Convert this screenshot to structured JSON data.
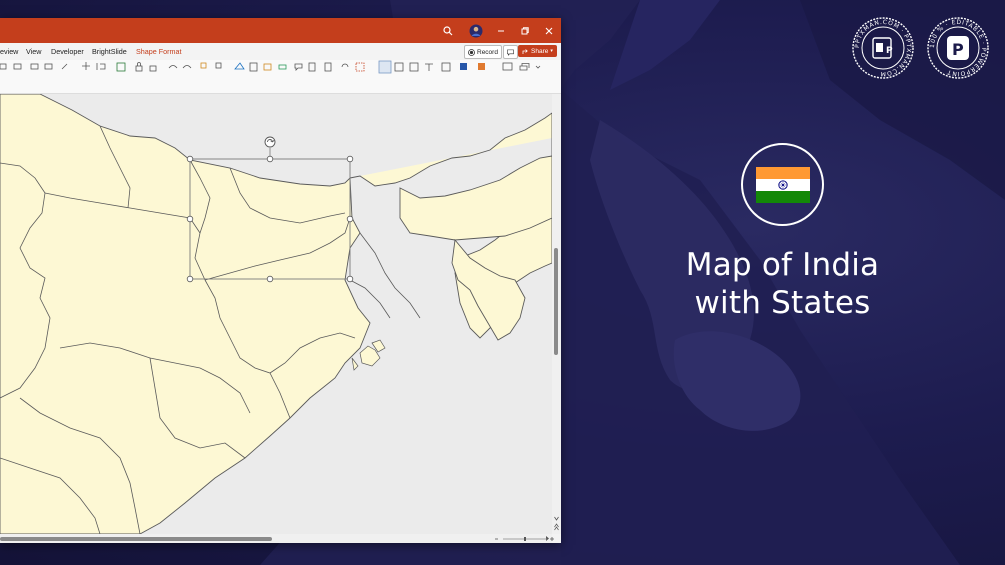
{
  "window": {
    "menu": [
      "eview",
      "View",
      "Developer",
      "BrightSlide",
      "Shape Format"
    ],
    "active_menu": "Shape Format",
    "record_label": "Record",
    "share_label": "Share"
  },
  "slide": {
    "title_line1": "Map of India",
    "title_line2": "with States"
  },
  "badges": {
    "left": "PPTXMAN.COM · PPTXMAN.COM",
    "right": "100 % · EDITABLE · POWERPOINT"
  },
  "colors": {
    "titlebar": "#c43e1c",
    "map_fill": "#fdf8d4",
    "map_stroke": "#5a5a5a",
    "sea": "#ebebeb",
    "background": "#1b1a4a",
    "flag_saffron": "#ff9933",
    "flag_green": "#138808",
    "flag_chakra": "#000080"
  },
  "icons": [
    "search-icon",
    "profile-icon",
    "minimize-icon",
    "restore-icon",
    "close-icon",
    "rotate-handle-icon"
  ]
}
